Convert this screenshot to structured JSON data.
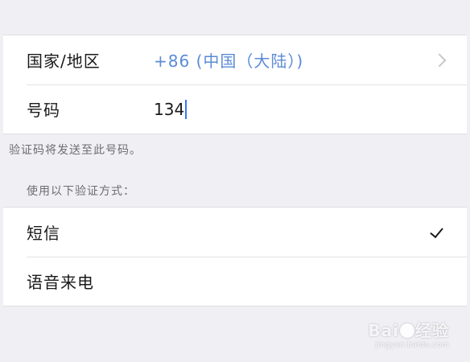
{
  "form": {
    "country": {
      "label": "国家/地区",
      "value": "+86 (中国（大陆）)"
    },
    "phone": {
      "label": "号码",
      "value": "134"
    }
  },
  "hint": "验证码将发送至此号码。",
  "verification": {
    "header": "使用以下验证方式：",
    "options": [
      {
        "label": "短信",
        "selected": true
      },
      {
        "label": "语音来电",
        "selected": false
      }
    ]
  },
  "watermark": {
    "brand_left": "Bai",
    "brand_right": "经验",
    "url": "jingyan.baidu.com"
  }
}
